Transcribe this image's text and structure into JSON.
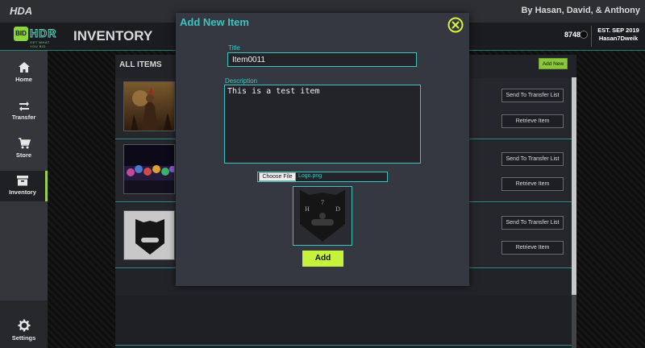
{
  "topbar": {
    "brand": "HDA",
    "credits": "By Hasan, David, & Anthony"
  },
  "header": {
    "logo": {
      "badge": "BID",
      "wordmark": "HDR",
      "tagline": "GET WHAT YOU BID"
    },
    "page_title": "INVENTORY",
    "coins": "8748",
    "established": "EST. SEP 2019",
    "username": "Hasan7Dweik"
  },
  "sidebar": {
    "items": [
      {
        "label": "Home",
        "icon": "home-icon"
      },
      {
        "label": "Transfer",
        "icon": "transfer-icon"
      },
      {
        "label": "Store",
        "icon": "cart-icon"
      },
      {
        "label": "Inventory",
        "icon": "archive-icon",
        "active": true
      }
    ],
    "settings": {
      "label": "Settings",
      "icon": "gear-icon"
    }
  },
  "items_panel": {
    "heading": "ALL ITEMS",
    "add_new_label": "Add New",
    "rows": [
      {
        "thumbnail": "warrior-artwork",
        "send_label": "Send To Transfer List",
        "retrieve_label": "Retrieve Item"
      },
      {
        "thumbnail": "heroes-artwork",
        "send_label": "Send To Transfer List",
        "retrieve_label": "Retrieve Item"
      },
      {
        "thumbnail": "h7d-logo",
        "send_label": "Send To Transfer List",
        "retrieve_label": "Retrieve Item"
      }
    ]
  },
  "modal": {
    "title": "Add New Item",
    "title_label": "Title",
    "title_value": "Item0011",
    "description_label": "Description",
    "description_value": "This is a test item",
    "choose_file_label": "Choose File",
    "file_name": "Logo.png",
    "logo_text": {
      "top": "7",
      "left": "H",
      "right": "D"
    },
    "submit_label": "Add"
  },
  "colors": {
    "accent_teal": "#3ec3c0",
    "accent_green": "#c6f33a",
    "modal_bg": "#363841"
  }
}
